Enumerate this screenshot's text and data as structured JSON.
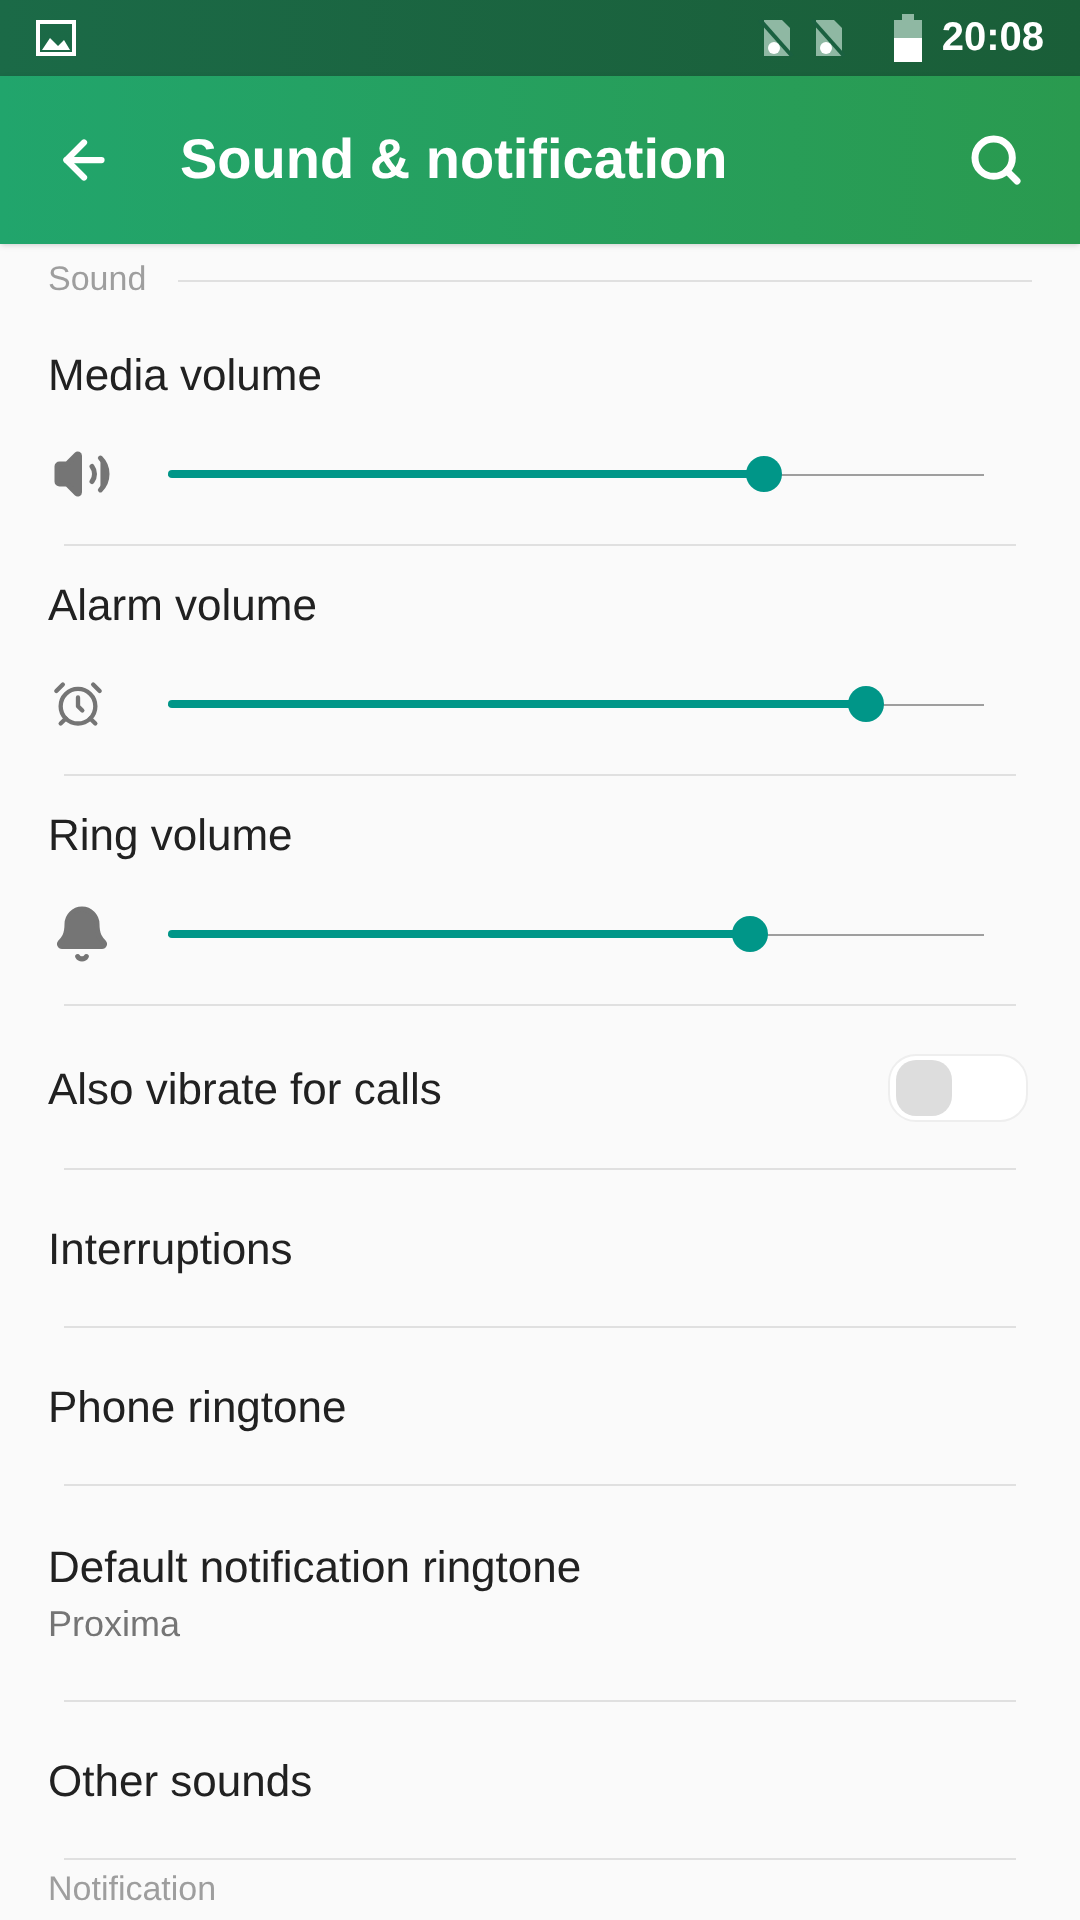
{
  "status_bar": {
    "time": "20:08"
  },
  "app_bar": {
    "title": "Sound & notification"
  },
  "sections": [
    {
      "header": "Sound",
      "items": [
        {
          "kind": "slider",
          "title": "Media volume",
          "level": 0.73
        },
        {
          "kind": "slider",
          "title": "Alarm volume",
          "level": 0.855
        },
        {
          "kind": "slider",
          "title": "Ring volume",
          "level": 0.713
        },
        {
          "kind": "toggle",
          "title": "Also vibrate for calls",
          "on": false
        },
        {
          "kind": "plain",
          "title": "Interruptions"
        },
        {
          "kind": "plain",
          "title": "Phone ringtone"
        },
        {
          "kind": "plain",
          "title": "Default notification ringtone",
          "summary": "Proxima"
        },
        {
          "kind": "plain",
          "title": "Other sounds"
        }
      ]
    },
    {
      "header": "Notification"
    }
  ]
}
